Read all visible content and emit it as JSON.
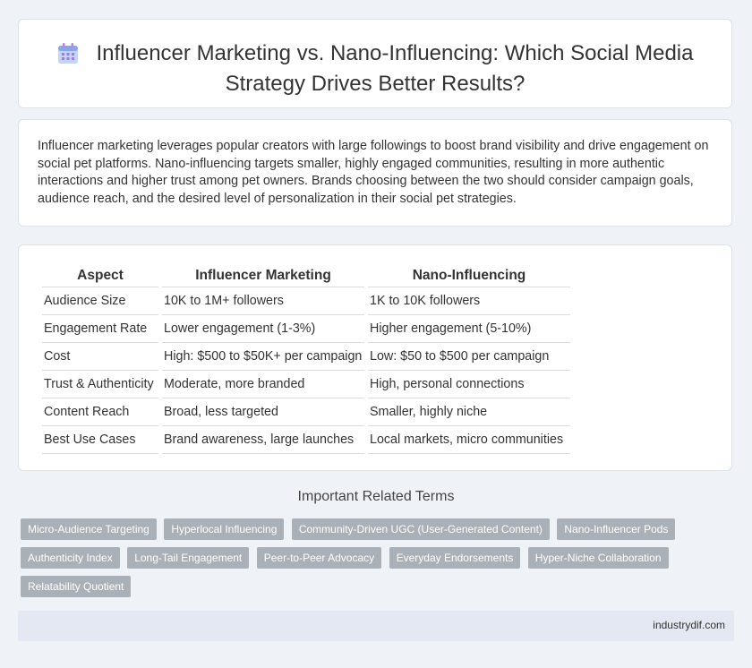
{
  "header": {
    "title_line1": "Influencer Marketing vs. Nano-Influencing: Which Social Media",
    "title_line2": "Strategy Drives Better Results?",
    "icon": "calendar-icon"
  },
  "intro": {
    "text": "Influencer marketing leverages popular creators with large followings to boost brand visibility and drive engagement on social pet platforms. Nano-influencing targets smaller, highly engaged communities, resulting in more authentic interactions and higher trust among pet owners. Brands choosing between the two should consider campaign goals, audience reach, and the desired level of personalization in their social pet strategies."
  },
  "table": {
    "headers": [
      "Aspect",
      "Influencer Marketing",
      "Nano-Influencing"
    ],
    "rows": [
      [
        "Audience Size",
        "10K to 1M+ followers",
        "1K to 10K followers"
      ],
      [
        "Engagement Rate",
        "Lower engagement (1-3%)",
        "Higher engagement (5-10%)"
      ],
      [
        "Cost",
        "High: $500 to $50K+ per campaign",
        "Low: $50 to $500 per campaign"
      ],
      [
        "Trust & Authenticity",
        "Moderate, more branded",
        "High, personal connections"
      ],
      [
        "Content Reach",
        "Broad, less targeted",
        "Smaller, highly niche"
      ],
      [
        "Best Use Cases",
        "Brand awareness, large launches",
        "Local markets, micro communities"
      ]
    ]
  },
  "related": {
    "title": "Important Related Terms",
    "tags": [
      "Micro-Audience Targeting",
      "Hyperlocal Influencing",
      "Community-Driven UGC (User-Generated Content)",
      "Nano-Influencer Pods",
      "Authenticity Index",
      "Long-Tail Engagement",
      "Peer-to-Peer Advocacy",
      "Everyday Endorsements",
      "Hyper-Niche Collaboration",
      "Relatability Quotient"
    ]
  },
  "footer": {
    "site": "industrydif.com"
  }
}
